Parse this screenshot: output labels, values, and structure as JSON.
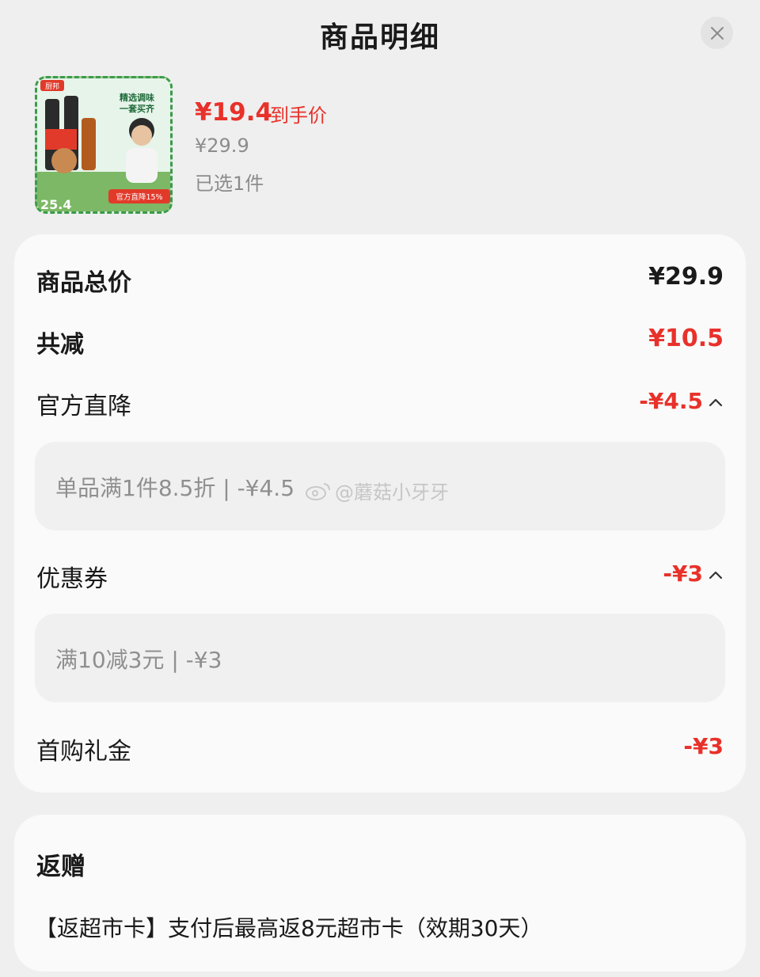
{
  "header": {
    "title": "商品明细",
    "close_icon": "close-icon"
  },
  "product": {
    "price_now": "¥19.4",
    "price_tag": "到手价",
    "price_original": "¥29.9",
    "selected": "已选1件",
    "image": {
      "brand": "厨邦",
      "headline_1": "精选调味",
      "headline_2": "一套买齐",
      "discount_label": "官方直降15%",
      "corner_number": "25.4"
    }
  },
  "summary": {
    "total_label": "商品总价",
    "total_value": "¥29.9",
    "reduce_label": "共减",
    "reduce_value": "¥10.5",
    "official_label": "官方直降",
    "official_value": "-¥4.5",
    "official_detail": "单品满1件8.5折 | -¥4.5",
    "coupon_label": "优惠券",
    "coupon_value": "-¥3",
    "coupon_detail": "满10减3元 | -¥3",
    "firstbuy_label": "首购礼金",
    "firstbuy_value": "-¥3"
  },
  "watermark": {
    "text": "@蘑菇小牙牙"
  },
  "gift": {
    "title": "返赠",
    "text": "【返超市卡】支付后最高返8元超市卡（效期30天）"
  },
  "colors": {
    "accent_red": "#e8312a",
    "muted_gray": "#8c8c8c",
    "card_bg": "#fafafa"
  }
}
